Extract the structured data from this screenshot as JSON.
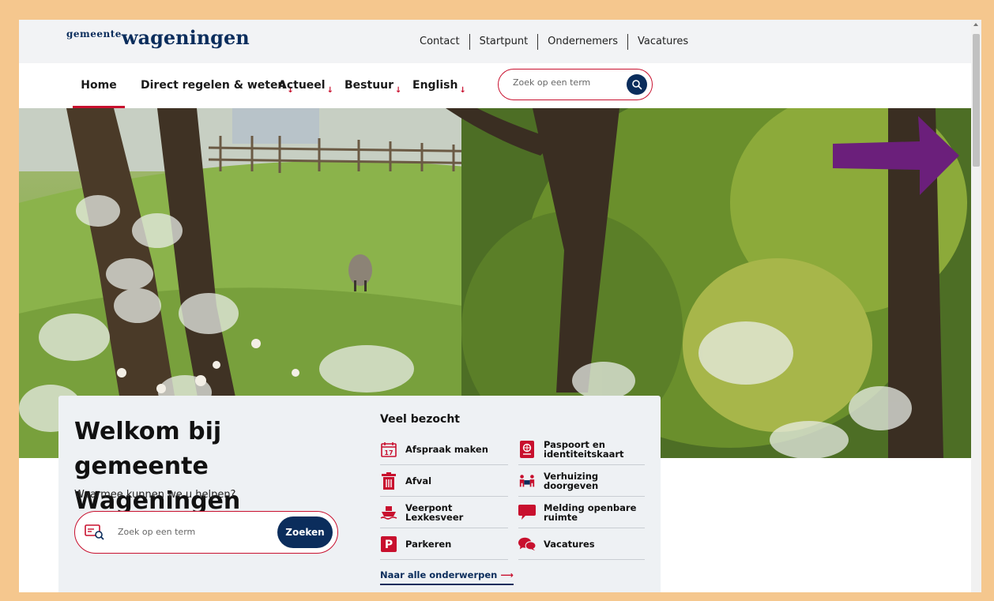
{
  "colors": {
    "brand_navy": "#0b2d5c",
    "accent_red": "#c8102e",
    "frame": "#f5c78e",
    "arrow_purple": "#6b1f7b"
  },
  "logo": {
    "small": "gemeente",
    "big": "wageningen"
  },
  "toplinks": [
    "Contact",
    "Startpunt",
    "Ondernemers",
    "Vacatures"
  ],
  "nav": {
    "items": [
      {
        "label": "Home"
      },
      {
        "label": "Direct regelen & weten"
      },
      {
        "label": "Actueel"
      },
      {
        "label": "Bestuur"
      },
      {
        "label": "English"
      }
    ],
    "search_placeholder": "Zoek op een term"
  },
  "welcome": {
    "title": "Welkom bij gemeente Wageningen",
    "subtitle": "Waarmee kunnen we u helpen?",
    "search_placeholder": "Zoek op een term",
    "search_button": "Zoeken"
  },
  "veel_bezocht": {
    "title": "Veel bezocht",
    "items": [
      {
        "label": "Afspraak maken",
        "icon": "calendar-icon",
        "calendar_day": "17"
      },
      {
        "label": "Paspoort en identiteitskaart",
        "icon": "passport-icon"
      },
      {
        "label": "Afval",
        "icon": "trash-icon"
      },
      {
        "label": "Verhuizing doorgeven",
        "icon": "moving-icon"
      },
      {
        "label": "Veerpont Lexkesveer",
        "icon": "ferry-icon"
      },
      {
        "label": "Melding openbare ruimte",
        "icon": "speech-bubble-icon"
      },
      {
        "label": "Parkeren",
        "icon": "parking-icon",
        "icon_letter": "P"
      },
      {
        "label": "Vacatures",
        "icon": "chat-bubbles-icon"
      }
    ],
    "all_topics_link": "Naar alle onderwerpen"
  }
}
